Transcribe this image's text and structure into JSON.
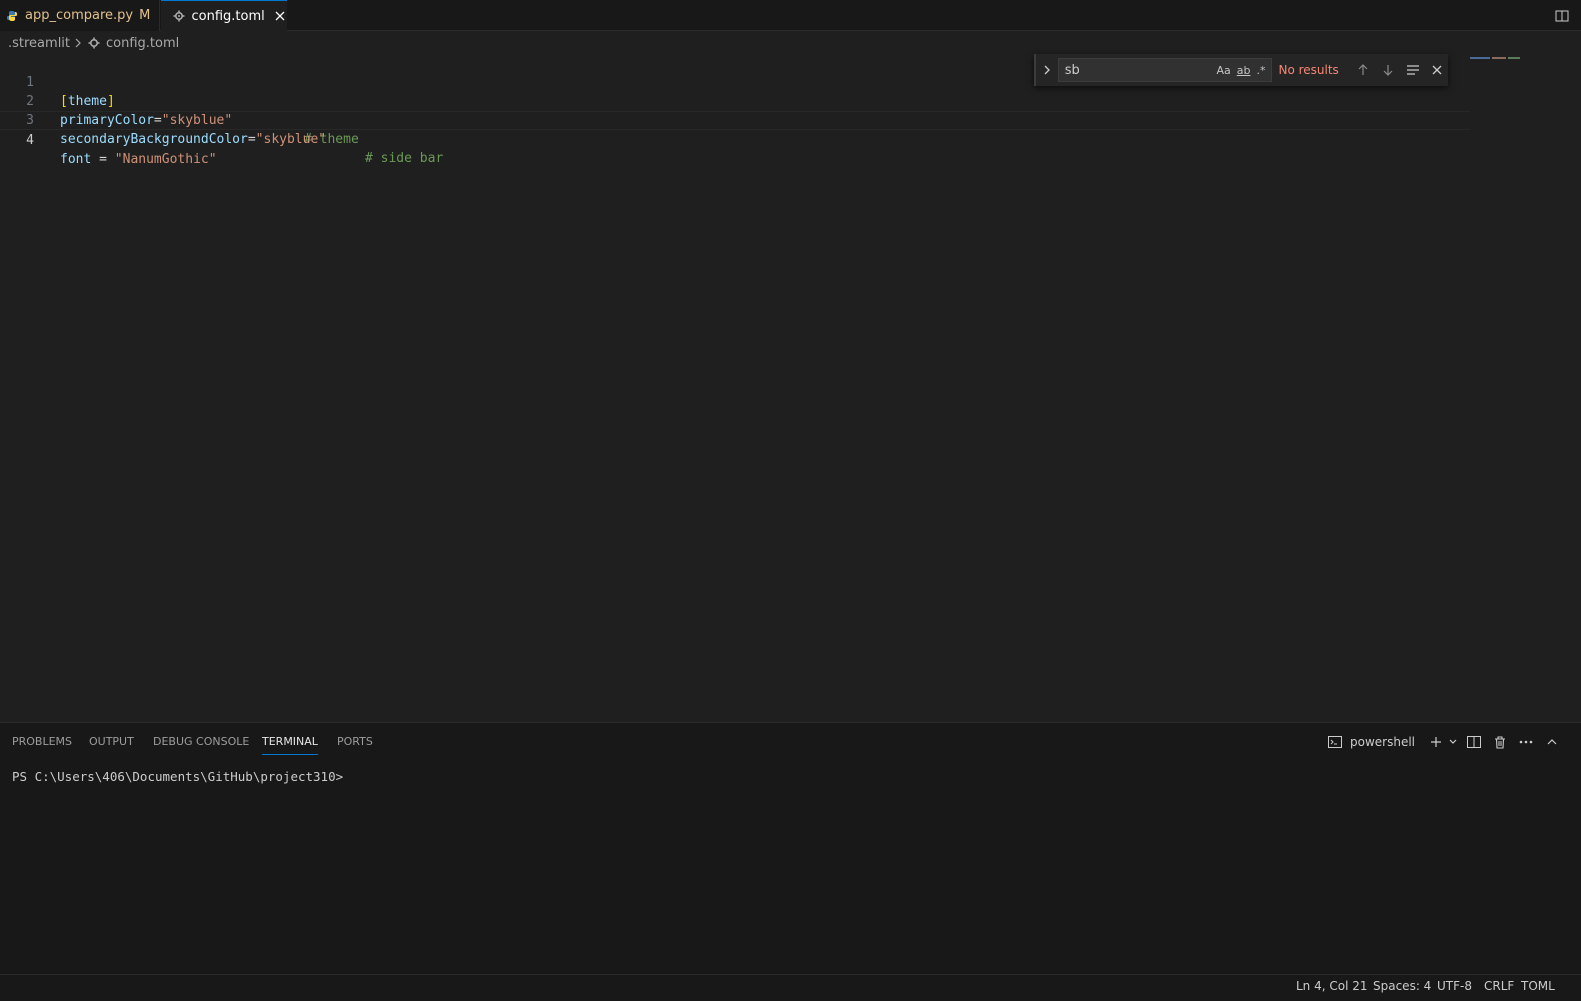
{
  "tabs": [
    {
      "label": "app_compare.py",
      "status": "M",
      "icon": "python-icon",
      "active": false
    },
    {
      "label": "config.toml",
      "icon": "gear-icon",
      "active": true
    }
  ],
  "breadcrumb": {
    "folder": ".streamlit",
    "file": "config.toml"
  },
  "editor": {
    "lines": [
      {
        "num": "1",
        "text": "[theme]"
      },
      {
        "num": "2",
        "key": "primaryColor",
        "eq": "=",
        "value": "\"skyblue\"",
        "comment": "# theme"
      },
      {
        "num": "3",
        "key": "secondaryBackgroundColor",
        "eq": "=",
        "value": "\"skyblue\"",
        "comment": "# side bar"
      },
      {
        "num": "4",
        "key": "font",
        "eq": " = ",
        "value": "\"NanumGothic\"",
        "current": true
      }
    ]
  },
  "find": {
    "value": "sb",
    "match_case": "Aa",
    "whole_word": "ab",
    "regex": ".*",
    "result": "No results"
  },
  "panel": {
    "tabs": [
      "PROBLEMS",
      "OUTPUT",
      "DEBUG CONSOLE",
      "TERMINAL",
      "PORTS"
    ],
    "active_tab": "TERMINAL",
    "shell": "powershell",
    "prompt": "PS C:\\Users\\406\\Documents\\GitHub\\project310>"
  },
  "statusbar": {
    "position": "Ln 4, Col 21",
    "spaces": "Spaces: 4",
    "encoding": "UTF-8",
    "eol": "CRLF",
    "language": "TOML"
  },
  "colors": {
    "accent": "#0078d4",
    "modified": "#e2c08d",
    "no_results": "#f48771"
  }
}
